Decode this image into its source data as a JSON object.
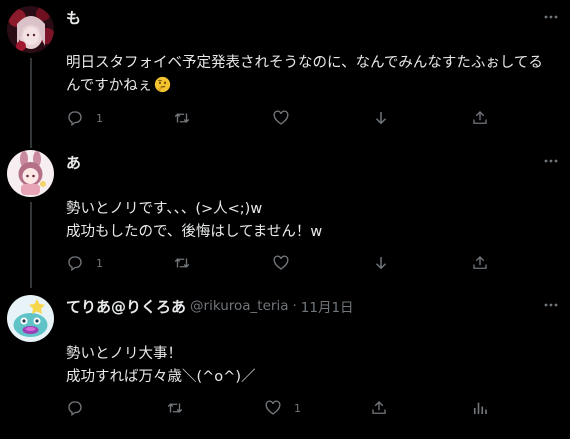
{
  "tweets": [
    {
      "display_name": "も",
      "handle": "",
      "separator": "",
      "date": "",
      "text_lines": [
        "明日スタフォイベ予定発表されそうなのに、なんでみんなすたふぉしてる",
        "んですかねぇ"
      ],
      "emoji": "thinking-face",
      "reply_count": "1",
      "retweet_count": "",
      "like_count": "",
      "views_count": ""
    },
    {
      "display_name": "あ",
      "handle": "",
      "separator": "",
      "date": "",
      "text_lines": [
        "勢いとノリです、、、(>人<;)w",
        "成功もしたので、後悔はしてません！w"
      ],
      "reply_count": "1",
      "retweet_count": "",
      "like_count": "",
      "views_count": ""
    },
    {
      "display_name": "てりあ@りくろあ",
      "handle": "@rikuroa_teria",
      "separator": "·",
      "date": "11月1日",
      "text_lines": [
        "勢いとノリ大事！",
        "成功すれば万々歳＼(^o^)／"
      ],
      "reply_count": "",
      "retweet_count": "",
      "like_count": "1",
      "views_count": ""
    }
  ],
  "colors": {
    "background": "#000000",
    "text_primary": "#e7e9ea",
    "text_secondary": "#71767b",
    "thread_line": "#333639"
  },
  "icons": [
    "reply-icon",
    "retweet-icon",
    "like-icon",
    "download-icon",
    "share-icon",
    "views-icon",
    "more-icon"
  ]
}
